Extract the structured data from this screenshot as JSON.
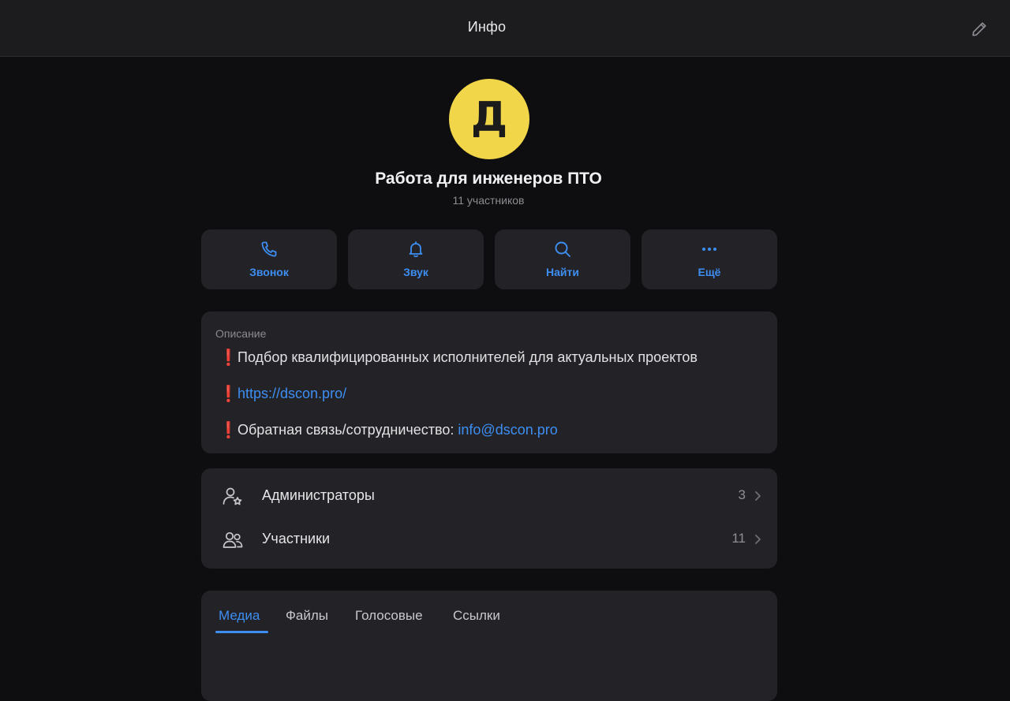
{
  "header": {
    "title": "Инфо",
    "edit_icon": "pencil-icon"
  },
  "profile": {
    "avatar_letter": "Д",
    "avatar_color": "#f2d64a",
    "title": "Работа для инженеров ПТО",
    "subtitle": "11 участников"
  },
  "actions": [
    {
      "label": "Звонок",
      "icon": "phone-icon"
    },
    {
      "label": "Звук",
      "icon": "bell-icon"
    },
    {
      "label": "Найти",
      "icon": "search-icon"
    },
    {
      "label": "Ещё",
      "icon": "more-icon"
    }
  ],
  "description": {
    "label": "Описание",
    "bullet": "❗",
    "line1": "Подбор квалифицированных исполнителей для актуальных проектов",
    "line2_link": "https://dscon.pro/",
    "line3_text": "Обратная связь/сотрудничество: ",
    "line3_link": "info@dscon.pro"
  },
  "members": [
    {
      "label": "Администраторы",
      "count": "3",
      "icon": "admin-icon"
    },
    {
      "label": "Участники",
      "count": "11",
      "icon": "members-icon"
    }
  ],
  "media_tabs": [
    {
      "label": "Медиа",
      "active": true
    },
    {
      "label": "Файлы",
      "active": false
    },
    {
      "label": "Голосовые",
      "active": false
    },
    {
      "label": "Ссылки",
      "active": false
    }
  ],
  "colors": {
    "accent": "#3d8ef2",
    "bullet": "#e8262b",
    "card": "#232327",
    "background": "#0e0e10"
  }
}
